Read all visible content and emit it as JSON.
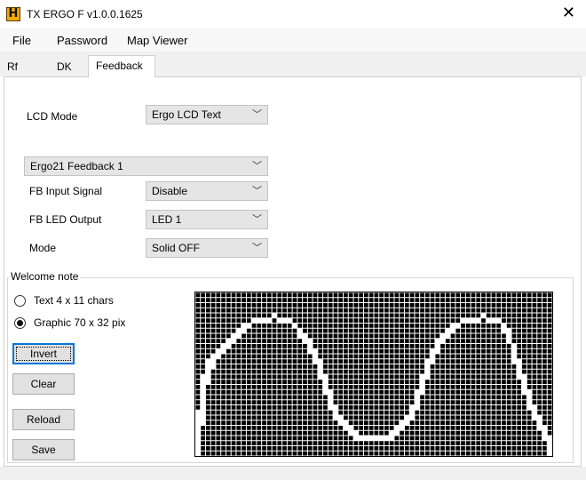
{
  "window": {
    "title": "TX ERGO F v1.0.0.1625",
    "icon": "H",
    "close_glyph": "✕"
  },
  "menu": {
    "items": [
      "File",
      "Password",
      "Map Viewer"
    ]
  },
  "tabs": [
    {
      "label": "Rf",
      "active": false
    },
    {
      "label": "DK",
      "active": false
    },
    {
      "label": "Feedback",
      "active": true
    }
  ],
  "feedback": {
    "lcd_mode": {
      "label": "LCD Mode",
      "value": "Ergo LCD Text"
    },
    "feedback_select": {
      "value": "Ergo21 Feedback 1"
    },
    "fb_input": {
      "label": "FB Input Signal",
      "value": "Disable"
    },
    "fb_led": {
      "label": "FB LED Output",
      "value": "LED 1"
    },
    "mode": {
      "label": "Mode",
      "value": "Solid OFF"
    }
  },
  "welcome": {
    "title": "Welcome note",
    "options": [
      {
        "label": "Text 4 x 11 chars",
        "selected": false
      },
      {
        "label": "Graphic 70 x 32 pix",
        "selected": true
      }
    ],
    "buttons": {
      "invert": "Invert",
      "clear": "Clear",
      "reload": "Reload",
      "save": "Save"
    },
    "bitmap": {
      "cols": 70,
      "rows": 32,
      "lit_cells": [
        [
          0,
          23
        ],
        [
          0,
          24
        ],
        [
          0,
          25
        ],
        [
          0,
          26
        ],
        [
          0,
          27
        ],
        [
          0,
          28
        ],
        [
          0,
          29
        ],
        [
          0,
          30
        ],
        [
          0,
          31
        ],
        [
          1,
          16
        ],
        [
          1,
          17
        ],
        [
          1,
          18
        ],
        [
          1,
          19
        ],
        [
          1,
          20
        ],
        [
          1,
          21
        ],
        [
          1,
          22
        ],
        [
          1,
          23
        ],
        [
          1,
          24
        ],
        [
          1,
          25
        ],
        [
          2,
          13
        ],
        [
          2,
          14
        ],
        [
          2,
          15
        ],
        [
          2,
          16
        ],
        [
          2,
          17
        ],
        [
          3,
          12
        ],
        [
          3,
          13
        ],
        [
          3,
          14
        ],
        [
          4,
          11
        ],
        [
          4,
          12
        ],
        [
          5,
          10
        ],
        [
          5,
          11
        ],
        [
          6,
          9
        ],
        [
          6,
          10
        ],
        [
          7,
          8
        ],
        [
          7,
          9
        ],
        [
          8,
          7
        ],
        [
          8,
          8
        ],
        [
          9,
          6
        ],
        [
          9,
          7
        ],
        [
          10,
          6
        ],
        [
          11,
          5
        ],
        [
          12,
          5
        ],
        [
          13,
          5
        ],
        [
          14,
          5
        ],
        [
          15,
          4
        ],
        [
          16,
          5
        ],
        [
          17,
          5
        ],
        [
          18,
          5
        ],
        [
          19,
          6
        ],
        [
          20,
          7
        ],
        [
          20,
          8
        ],
        [
          21,
          8
        ],
        [
          21,
          9
        ],
        [
          22,
          9
        ],
        [
          22,
          10
        ],
        [
          22,
          11
        ],
        [
          23,
          11
        ],
        [
          23,
          12
        ],
        [
          23,
          13
        ],
        [
          24,
          13
        ],
        [
          24,
          14
        ],
        [
          24,
          15
        ],
        [
          24,
          16
        ],
        [
          25,
          16
        ],
        [
          25,
          17
        ],
        [
          25,
          18
        ],
        [
          25,
          19
        ],
        [
          26,
          19
        ],
        [
          26,
          20
        ],
        [
          26,
          21
        ],
        [
          26,
          22
        ],
        [
          27,
          22
        ],
        [
          27,
          23
        ],
        [
          27,
          24
        ],
        [
          28,
          24
        ],
        [
          28,
          25
        ],
        [
          29,
          25
        ],
        [
          29,
          26
        ],
        [
          30,
          26
        ],
        [
          30,
          27
        ],
        [
          31,
          27
        ],
        [
          31,
          28
        ],
        [
          32,
          28
        ],
        [
          33,
          28
        ],
        [
          34,
          28
        ],
        [
          35,
          28
        ],
        [
          36,
          28
        ],
        [
          37,
          28
        ],
        [
          38,
          28
        ],
        [
          38,
          27
        ],
        [
          39,
          27
        ],
        [
          39,
          26
        ],
        [
          40,
          26
        ],
        [
          40,
          25
        ],
        [
          41,
          25
        ],
        [
          41,
          24
        ],
        [
          42,
          24
        ],
        [
          42,
          23
        ],
        [
          42,
          22
        ],
        [
          43,
          22
        ],
        [
          43,
          21
        ],
        [
          43,
          20
        ],
        [
          43,
          19
        ],
        [
          44,
          19
        ],
        [
          44,
          18
        ],
        [
          44,
          17
        ],
        [
          44,
          16
        ],
        [
          45,
          16
        ],
        [
          45,
          15
        ],
        [
          45,
          14
        ],
        [
          45,
          13
        ],
        [
          46,
          13
        ],
        [
          46,
          12
        ],
        [
          46,
          11
        ],
        [
          47,
          11
        ],
        [
          47,
          10
        ],
        [
          47,
          9
        ],
        [
          48,
          9
        ],
        [
          48,
          8
        ],
        [
          49,
          8
        ],
        [
          49,
          7
        ],
        [
          50,
          7
        ],
        [
          50,
          6
        ],
        [
          51,
          6
        ],
        [
          52,
          5
        ],
        [
          53,
          5
        ],
        [
          54,
          5
        ],
        [
          55,
          5
        ],
        [
          56,
          4
        ],
        [
          57,
          5
        ],
        [
          58,
          5
        ],
        [
          59,
          5
        ],
        [
          60,
          6
        ],
        [
          60,
          7
        ],
        [
          61,
          7
        ],
        [
          61,
          8
        ],
        [
          61,
          9
        ],
        [
          62,
          10
        ],
        [
          62,
          11
        ],
        [
          62,
          12
        ],
        [
          62,
          13
        ],
        [
          63,
          13
        ],
        [
          63,
          14
        ],
        [
          63,
          15
        ],
        [
          63,
          16
        ],
        [
          64,
          16
        ],
        [
          64,
          17
        ],
        [
          64,
          18
        ],
        [
          64,
          19
        ],
        [
          65,
          19
        ],
        [
          65,
          20
        ],
        [
          65,
          21
        ],
        [
          65,
          22
        ],
        [
          66,
          22
        ],
        [
          66,
          23
        ],
        [
          66,
          24
        ],
        [
          67,
          24
        ],
        [
          67,
          25
        ],
        [
          67,
          26
        ],
        [
          68,
          26
        ],
        [
          68,
          27
        ],
        [
          68,
          28
        ],
        [
          69,
          28
        ],
        [
          69,
          29
        ],
        [
          69,
          30
        ],
        [
          69,
          31
        ]
      ]
    }
  },
  "colors": {
    "focus_blue": "#0078d7",
    "title_icon": "#f2a900"
  }
}
